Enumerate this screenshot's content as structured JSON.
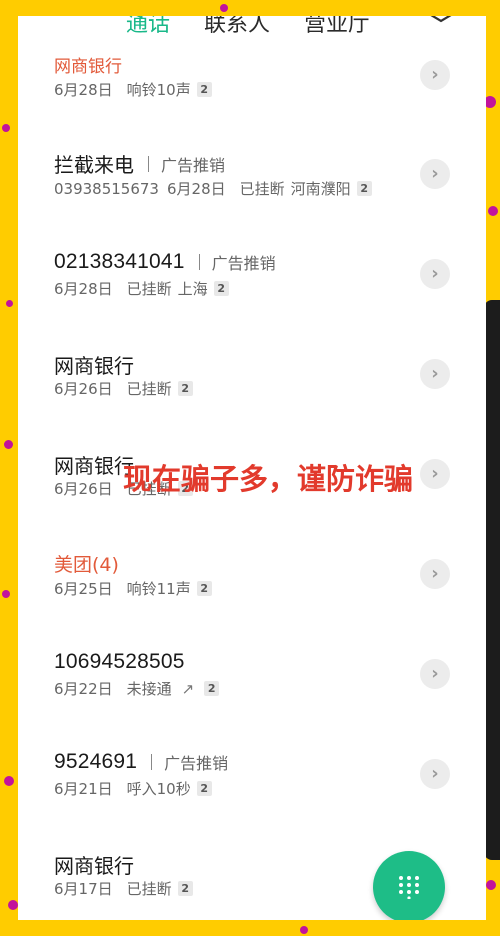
{
  "tabs": [
    {
      "label": "通话",
      "active": true
    },
    {
      "label": "联系人",
      "active": false
    },
    {
      "label": "营业厅",
      "active": false
    }
  ],
  "accent_color": "#19b889",
  "icons": {
    "settings": "settings-icon",
    "details": "chevron-right-icon",
    "dialpad": "dialpad-icon",
    "outgoing": "outgoing-call-icon"
  },
  "calls": [
    {
      "title": "网商银行",
      "title_color": "red",
      "date": "6月28日",
      "status": "响铃10声",
      "sim": "2"
    },
    {
      "title": "拦截来电",
      "tag": "广告推销",
      "number": "03938515673",
      "date": "6月28日",
      "status": "已挂断",
      "location": "河南濮阳",
      "sim": "2"
    },
    {
      "title": "02138341041",
      "tag": "广告推销",
      "date": "6月28日",
      "status": "已挂断",
      "location": "上海",
      "sim": "2"
    },
    {
      "title": "网商银行",
      "date": "6月26日",
      "status": "已挂断",
      "sim": "2"
    },
    {
      "title": "网商银行",
      "date": "6月26日",
      "status": "已挂断",
      "sim": "2"
    },
    {
      "title": "美团(4)",
      "title_color": "red",
      "date": "6月25日",
      "status": "响铃11声",
      "sim": "2"
    },
    {
      "title": "10694528505",
      "date": "6月22日",
      "status": "未接通",
      "outgoing": true,
      "sim": "2"
    },
    {
      "title": "9524691",
      "tag": "广告推销",
      "date": "6月21日",
      "status": "呼入10秒",
      "sim": "2"
    },
    {
      "title": "网商银行",
      "date": "6月17日",
      "status": "已挂断",
      "sim": "2"
    }
  ],
  "overlay_text": "现在骗子多，谨防诈骗",
  "chevron_glyph": "›",
  "outgoing_glyph": "↗"
}
